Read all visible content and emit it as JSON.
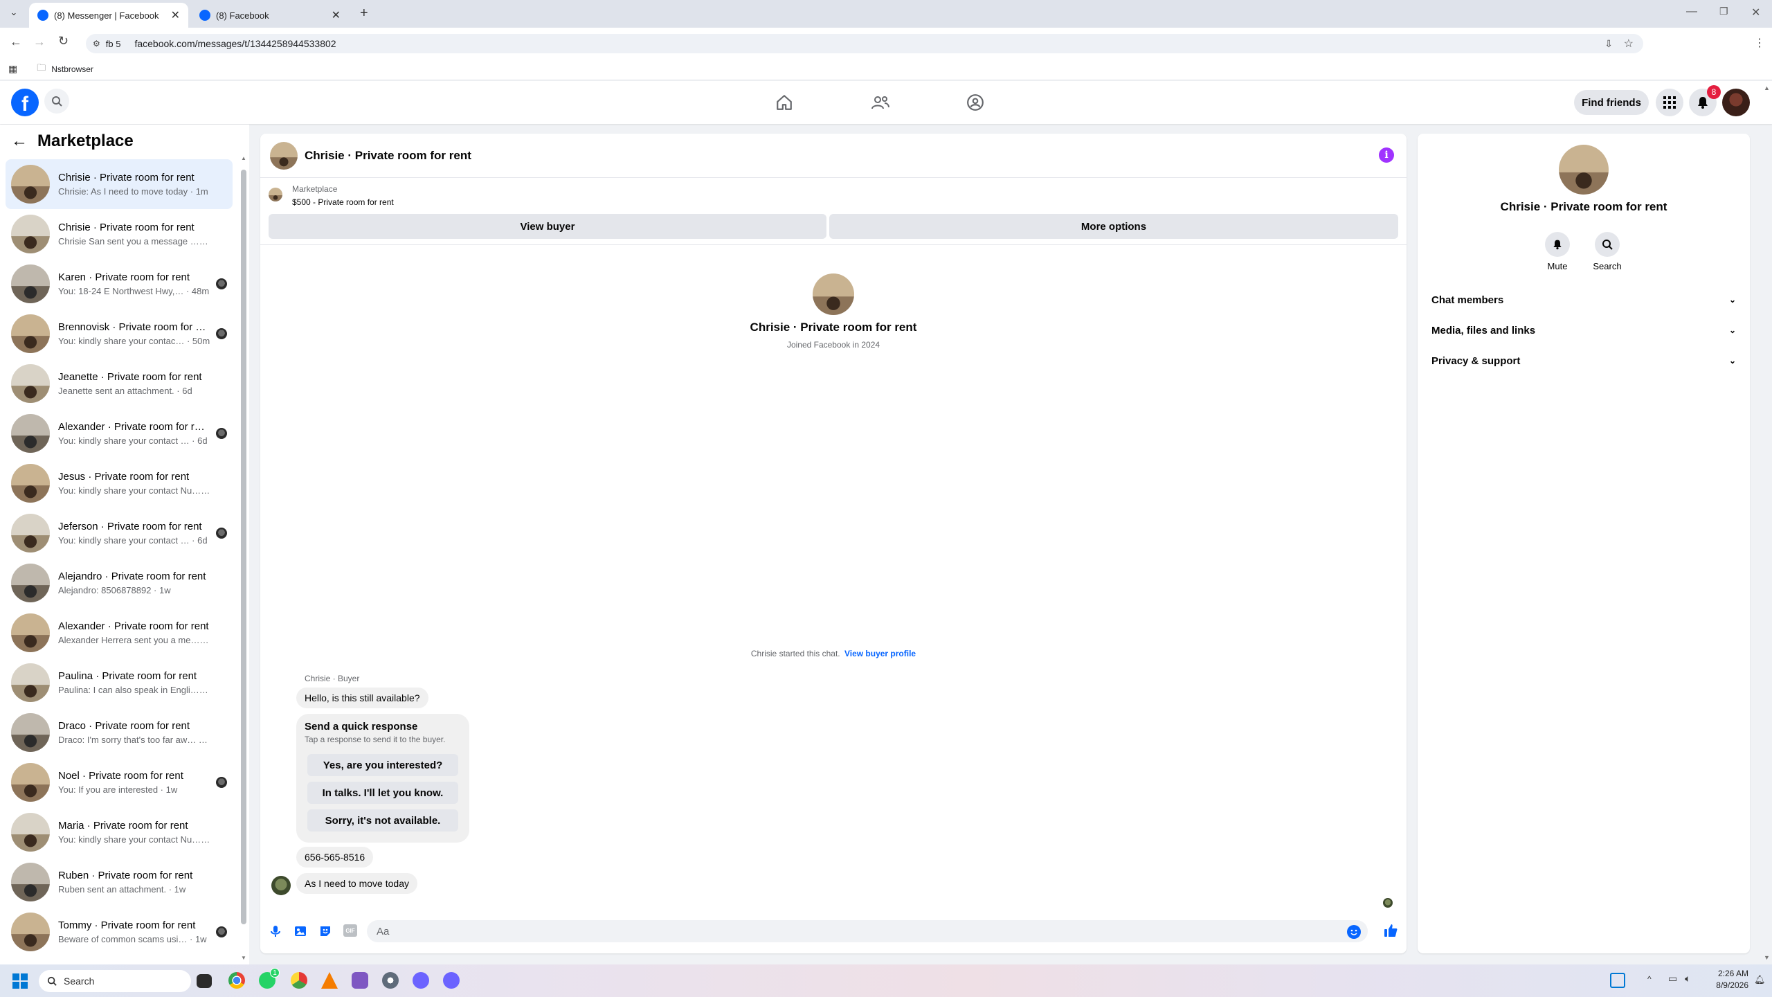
{
  "browser": {
    "tabs": [
      {
        "title": "(8) Messenger | Facebook"
      },
      {
        "title": "(8) Facebook"
      }
    ],
    "profile_chip": "fb 5",
    "url": "facebook.com/messages/t/1344258944533802",
    "bookmark_folder": "Nstbrowser"
  },
  "header": {
    "find_friends": "Find friends",
    "notification_count": "8"
  },
  "sidebar": {
    "title": "Marketplace",
    "conversations": [
      {
        "title": "Chrisie · Private room for rent",
        "preview": "Chrisie: As I need to move today · 1m"
      },
      {
        "title": "Chrisie · Private room for rent",
        "preview": "Chrisie San sent you a message … · 1m"
      },
      {
        "title": "Karen · Private room for rent",
        "preview": "You: 18-24 E Northwest Hwy,… · 48m"
      },
      {
        "title": "Brennovisk · Private room for …",
        "preview": "You: kindly share your contac… · 50m"
      },
      {
        "title": "Jeanette · Private room for rent",
        "preview": "Jeanette sent an attachment. · 6d"
      },
      {
        "title": "Alexander · Private room for r…",
        "preview": "You: kindly share your contact … · 6d"
      },
      {
        "title": "Jesus · Private room for rent",
        "preview": "You: kindly share your contact Nu… · 6d"
      },
      {
        "title": "Jeferson · Private room for rent",
        "preview": "You: kindly share your contact … · 6d"
      },
      {
        "title": "Alejandro · Private room for rent",
        "preview": "Alejandro: 8506878892 · 1w"
      },
      {
        "title": "Alexander · Private room for rent",
        "preview": "Alexander Herrera sent you a me… · 1w"
      },
      {
        "title": "Paulina · Private room for rent",
        "preview": "Paulina: I can also speak in Engli… · 1w"
      },
      {
        "title": "Draco · Private room for rent",
        "preview": "Draco: I'm sorry that's too far aw… · 1w"
      },
      {
        "title": "Noel · Private room for rent",
        "preview": "You: If you are interested · 1w"
      },
      {
        "title": "Maria · Private room for rent",
        "preview": "You: kindly share your contact Nu… · 1w"
      },
      {
        "title": "Ruben · Private room for rent",
        "preview": "Ruben sent an attachment. · 1w"
      },
      {
        "title": "Tommy · Private room for rent",
        "preview": "Beware of common scams usi… · 1w"
      }
    ]
  },
  "chat": {
    "title": "Chrisie · Private room for rent",
    "listing_label": "Marketplace",
    "listing_name": "$500 - Private room for rent",
    "view_buyer": "View buyer",
    "more_options": "More options",
    "profile_name": "Chrisie · Private room for rent",
    "joined": "Joined Facebook in 2024",
    "started_text": "Chrisie started this chat.",
    "view_buyer_profile": "View buyer profile",
    "sender_label": "Chrisie · Buyer",
    "msg1": "Hello, is this still available?",
    "quick_title": "Send a quick response",
    "quick_sub": "Tap a response to send it to the buyer.",
    "quick_replies": [
      "Yes, are you interested?",
      "In talks. I'll let you know.",
      "Sorry, it's not available."
    ],
    "msg2": "656-565-8516",
    "msg3": "As I need to move today",
    "composer_placeholder": "Aa"
  },
  "right_panel": {
    "name": "Chrisie · Private room for rent",
    "mute": "Mute",
    "search": "Search",
    "sections": [
      "Chat members",
      "Media, files and links",
      "Privacy & support"
    ]
  },
  "taskbar": {
    "search": "Search",
    "whatsapp_badge": "1",
    "time": "2:26 AM",
    "date": "8/9/2026"
  },
  "colors": {
    "fb_blue": "#0866ff",
    "purple_info": "#a033ff",
    "notif_red": "#e41e3f"
  }
}
